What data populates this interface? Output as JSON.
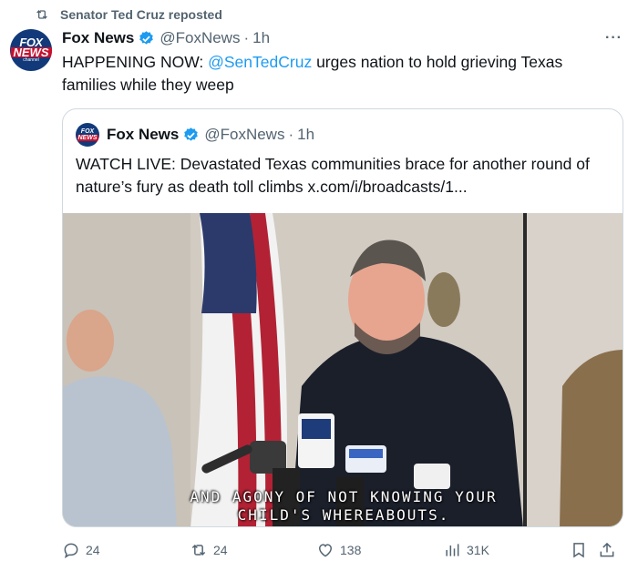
{
  "repost": {
    "label": "Senator Ted Cruz reposted"
  },
  "tweet": {
    "author_name": "Fox News",
    "handle": "@FoxNews",
    "time": "1h",
    "text_prefix": "HAPPENING NOW: ",
    "mention": "@SenTedCruz",
    "text_suffix": " urges nation to hold grieving Texas families while they weep"
  },
  "quote": {
    "author_name": "Fox News",
    "handle": "@FoxNews",
    "time": "1h",
    "text": "WATCH LIVE: Devastated Texas communities brace for another round of nature’s fury as death toll climbs  x.com/i/broadcasts/1...",
    "caption_line1": "AND AGONY OF NOT KNOWING YOUR",
    "caption_line2": "CHILD'S WHEREABOUTS."
  },
  "logo": {
    "line1": "FOX",
    "line2": "NEWS",
    "line3": "channel"
  },
  "actions": {
    "replies": "24",
    "reposts": "24",
    "likes": "138",
    "views": "31K"
  },
  "more_label": "···",
  "dot": "·",
  "icons": {
    "repost": "repost-icon",
    "verified": "verified-badge-icon",
    "reply": "reply-icon",
    "like": "heart-icon",
    "views": "analytics-icon",
    "bookmark": "bookmark-icon",
    "share": "share-icon"
  },
  "colors": {
    "accent": "#1d9bf0",
    "muted": "#536471",
    "text": "#0f1419",
    "border": "#cfd9de",
    "fox_blue": "#123a7a",
    "fox_red": "#c8102e"
  }
}
